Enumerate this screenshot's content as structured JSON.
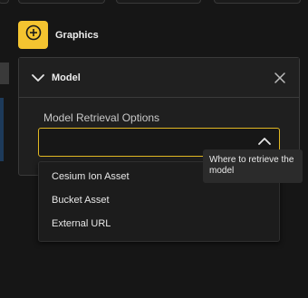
{
  "graphics": {
    "label": "Graphics",
    "icon": "plus-circle-icon",
    "accent": "#f4c430"
  },
  "model": {
    "label": "Model",
    "collapse_icon": "chevron-down-icon",
    "close_icon": "close-icon"
  },
  "retrieval": {
    "label": "Model Retrieval Options",
    "value": "",
    "dropdown_icon": "chevron-up-icon",
    "focus_color": "#e1b823",
    "tooltip": "Where to retrieve the model",
    "options": [
      "Cesium Ion Asset",
      "Bucket Asset",
      "External URL"
    ]
  }
}
